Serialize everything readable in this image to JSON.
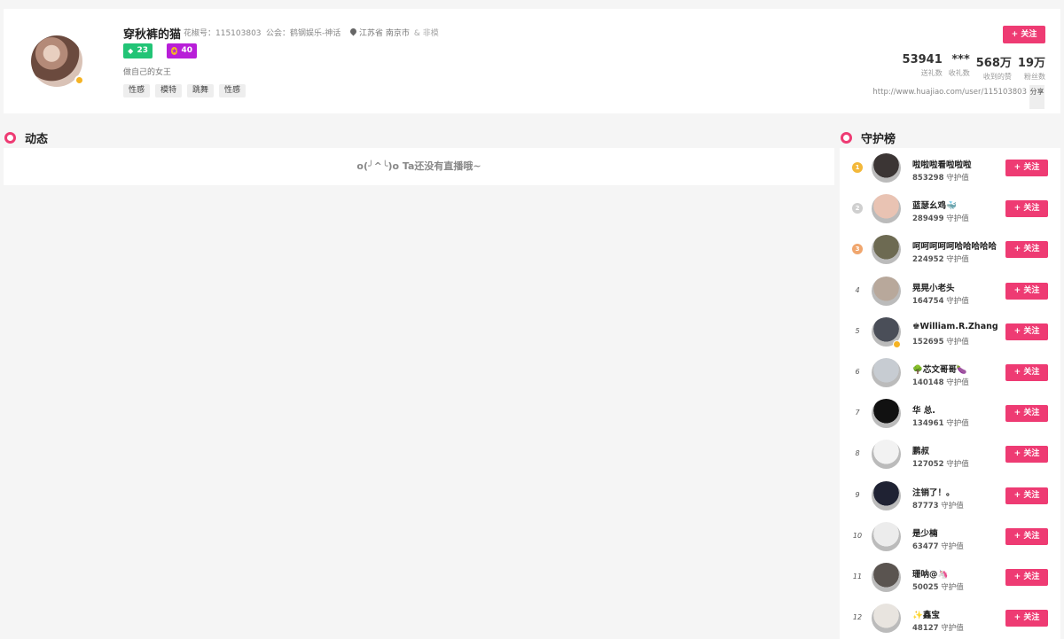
{
  "profile": {
    "name": "穿秋裤的猫",
    "id_text": "花椒号：115103803",
    "guild_text": "公会：鹤钢娱乐-神话",
    "location": "江苏省 南京市",
    "location_extra": "& 非模",
    "level_green": "23",
    "level_purple": "40",
    "bio": "做自己的女王",
    "tags": [
      "性感",
      "模特",
      "跳舞",
      "性感"
    ],
    "follow_label": "+ 关注",
    "stats": [
      {
        "value": "53941",
        "label": "送礼数"
      },
      {
        "value": "***",
        "label": "收礼数"
      },
      {
        "value": "568万",
        "label": "收到的赞"
      },
      {
        "value": "19万",
        "label": "粉丝数"
      }
    ],
    "url": "http://www.huajiao.com/user/115103803",
    "share_label": "分享"
  },
  "dynamics": {
    "title": "动态",
    "empty_text": "o(╯^╰)o Ta还没有直播哦~"
  },
  "guardians": {
    "title": "守护榜",
    "value_suffix": "守护值",
    "follow_label": "+ 关注",
    "items": [
      {
        "rank": "1",
        "name": "啦啦啦看啦啦啦",
        "value": "853298",
        "medal": "#f3b83a",
        "avatar": "#3b3534"
      },
      {
        "rank": "2",
        "name": "蓝瑟幺鸡🐳",
        "value": "289499",
        "medal": "#cfcfcf",
        "avatar": "#e9c3b3"
      },
      {
        "rank": "3",
        "name": "呵呵呵呵呵哈哈哈哈哈",
        "value": "224952",
        "medal": "#f0a66e",
        "avatar": "#6d6a52"
      },
      {
        "rank": "4",
        "name": "晃晃小老头",
        "value": "164754",
        "medal": "",
        "avatar": "#b8a89b"
      },
      {
        "rank": "5",
        "name": "♚William.R.Zhang",
        "value": "152695",
        "medal": "",
        "avatar": "#4a4e58",
        "verified": true
      },
      {
        "rank": "6",
        "name": "🌳芯文哥哥🍆",
        "value": "140148",
        "medal": "",
        "avatar": "#c7ccd2"
      },
      {
        "rank": "7",
        "name": "华 总.",
        "value": "134961",
        "medal": "",
        "avatar": "#111111"
      },
      {
        "rank": "8",
        "name": "鹏叔",
        "value": "127052",
        "medal": "",
        "avatar": "#f2f2f2"
      },
      {
        "rank": "9",
        "name": "注销了！。",
        "value": "87773",
        "medal": "",
        "avatar": "#1f2233"
      },
      {
        "rank": "10",
        "name": "是少楠",
        "value": "63477",
        "medal": "",
        "avatar": "#ececec"
      },
      {
        "rank": "11",
        "name": "珊呐@🦄",
        "value": "50025",
        "medal": "",
        "avatar": "#5a5450"
      },
      {
        "rank": "12",
        "name": "✨鑫宝",
        "value": "48127",
        "medal": "",
        "avatar": "#e8e4df"
      }
    ]
  }
}
